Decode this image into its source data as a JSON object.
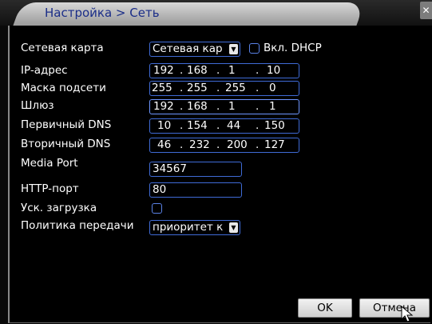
{
  "window": {
    "title": "Настройка > Сеть",
    "close_glyph": "✕"
  },
  "labels": {
    "network_card": "Сетевая карта",
    "ip": "IP-адрес",
    "subnet": "Маска подсети",
    "gateway": "Шлюз",
    "dns1": "Первичный DNS",
    "dns2": "Вторичный DNS",
    "media_port": "Media Port",
    "http_port": "HTTP-порт",
    "fast_boot": "Уск. загрузка",
    "transfer_policy": "Политика передачи"
  },
  "network_card": {
    "value": "Сетевая кар",
    "arrow": "▼"
  },
  "dhcp": {
    "label": "Вкл. DHCP",
    "checked": false
  },
  "ip": [
    "192",
    "168",
    "1",
    "10"
  ],
  "subnet": [
    "255",
    "255",
    "255",
    "0"
  ],
  "gateway": [
    "192",
    "168",
    "1",
    "1"
  ],
  "dns1": [
    "10",
    "154",
    "44",
    "150"
  ],
  "dns2": [
    "46",
    "232",
    "200",
    "127"
  ],
  "ports": {
    "media": "34567",
    "http": "80"
  },
  "fast_boot": {
    "checked": false
  },
  "transfer_policy": {
    "value": "приоритет к",
    "arrow": "▼"
  },
  "buttons": {
    "ok": "OK",
    "cancel": "Отмена"
  },
  "colors": {
    "field_border": "#3f6bd6",
    "title_text": "#1a2d88",
    "background": "#000000",
    "text": "#ffffff"
  }
}
